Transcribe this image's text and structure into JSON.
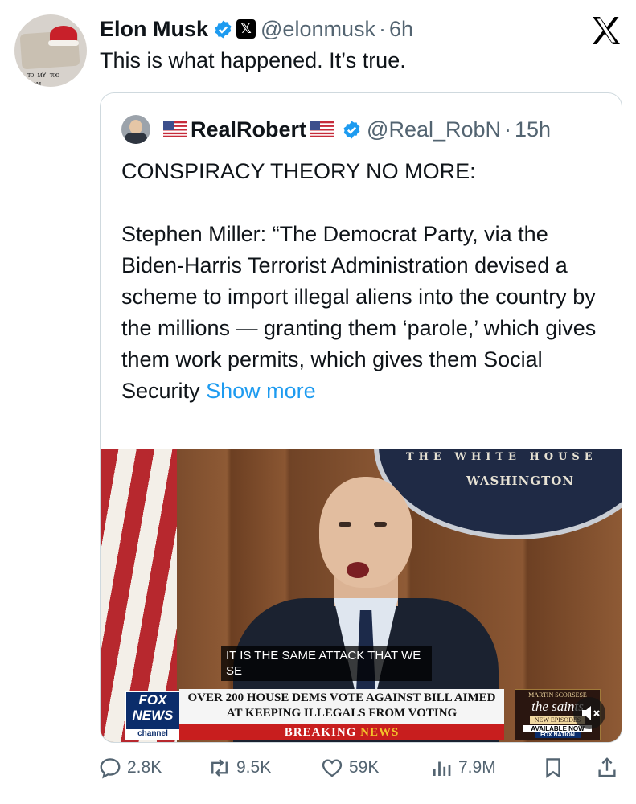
{
  "post": {
    "author_name": "Elon Musk",
    "author_handle": "@elonmusk",
    "separator": "·",
    "time": "6h",
    "text": "This is what happened. It’s true.",
    "avatar_scribble": "ᴛᴏ ᴍʏ ᴛᴏᴏ ᴛᴇᴀᴍ"
  },
  "quote": {
    "author_name": "RealRobert",
    "author_handle": "@Real_RobN",
    "separator": "·",
    "time": "15h",
    "line1": "CONSPIRACY THEORY NO MORE:",
    "body": "Stephen Miller: “The Democrat Party, via the Biden-Harris Terrorist Administration devised a scheme to import illegal aliens into the country by the millions — granting them ‘parole,’ which gives them work permits, which gives them Social Security",
    "show_more": "Show more"
  },
  "video": {
    "seal_arc": "THE WHITE HOUSE",
    "seal_text": "WASHINGTON",
    "caption": "IT IS THE SAME ATTACK THAT WE SE",
    "fox_logo_line1": "FOX",
    "fox_logo_line2": "NEWS",
    "fox_logo_channel": "channel",
    "headline": "OVER 200 HOUSE DEMS VOTE AGAINST BILL AIMED AT KEEPING ILLEGALS FROM VOTING",
    "breaking_1": "BREAKING",
    "breaking_2": "NEWS",
    "promo_top": "MARTIN SCORSESE",
    "promo_title": "the saints",
    "promo_episode": "NEW EPISODES",
    "promo_available": "AVAILABLE NOW",
    "promo_network": "FOX NATION"
  },
  "actions": {
    "replies": "2.8K",
    "reposts": "9.5K",
    "likes": "59K",
    "views": "7.9M"
  },
  "icons": [
    "verified-badge-icon",
    "x-affiliate-icon",
    "x-logo-icon",
    "us-flag-icon",
    "reply-icon",
    "repost-icon",
    "like-icon",
    "views-icon",
    "bookmark-icon",
    "share-icon",
    "mute-icon"
  ],
  "colors": {
    "accent": "#1d9bf0",
    "muted": "#536471",
    "text": "#0f1419",
    "border": "#cfd9de"
  }
}
